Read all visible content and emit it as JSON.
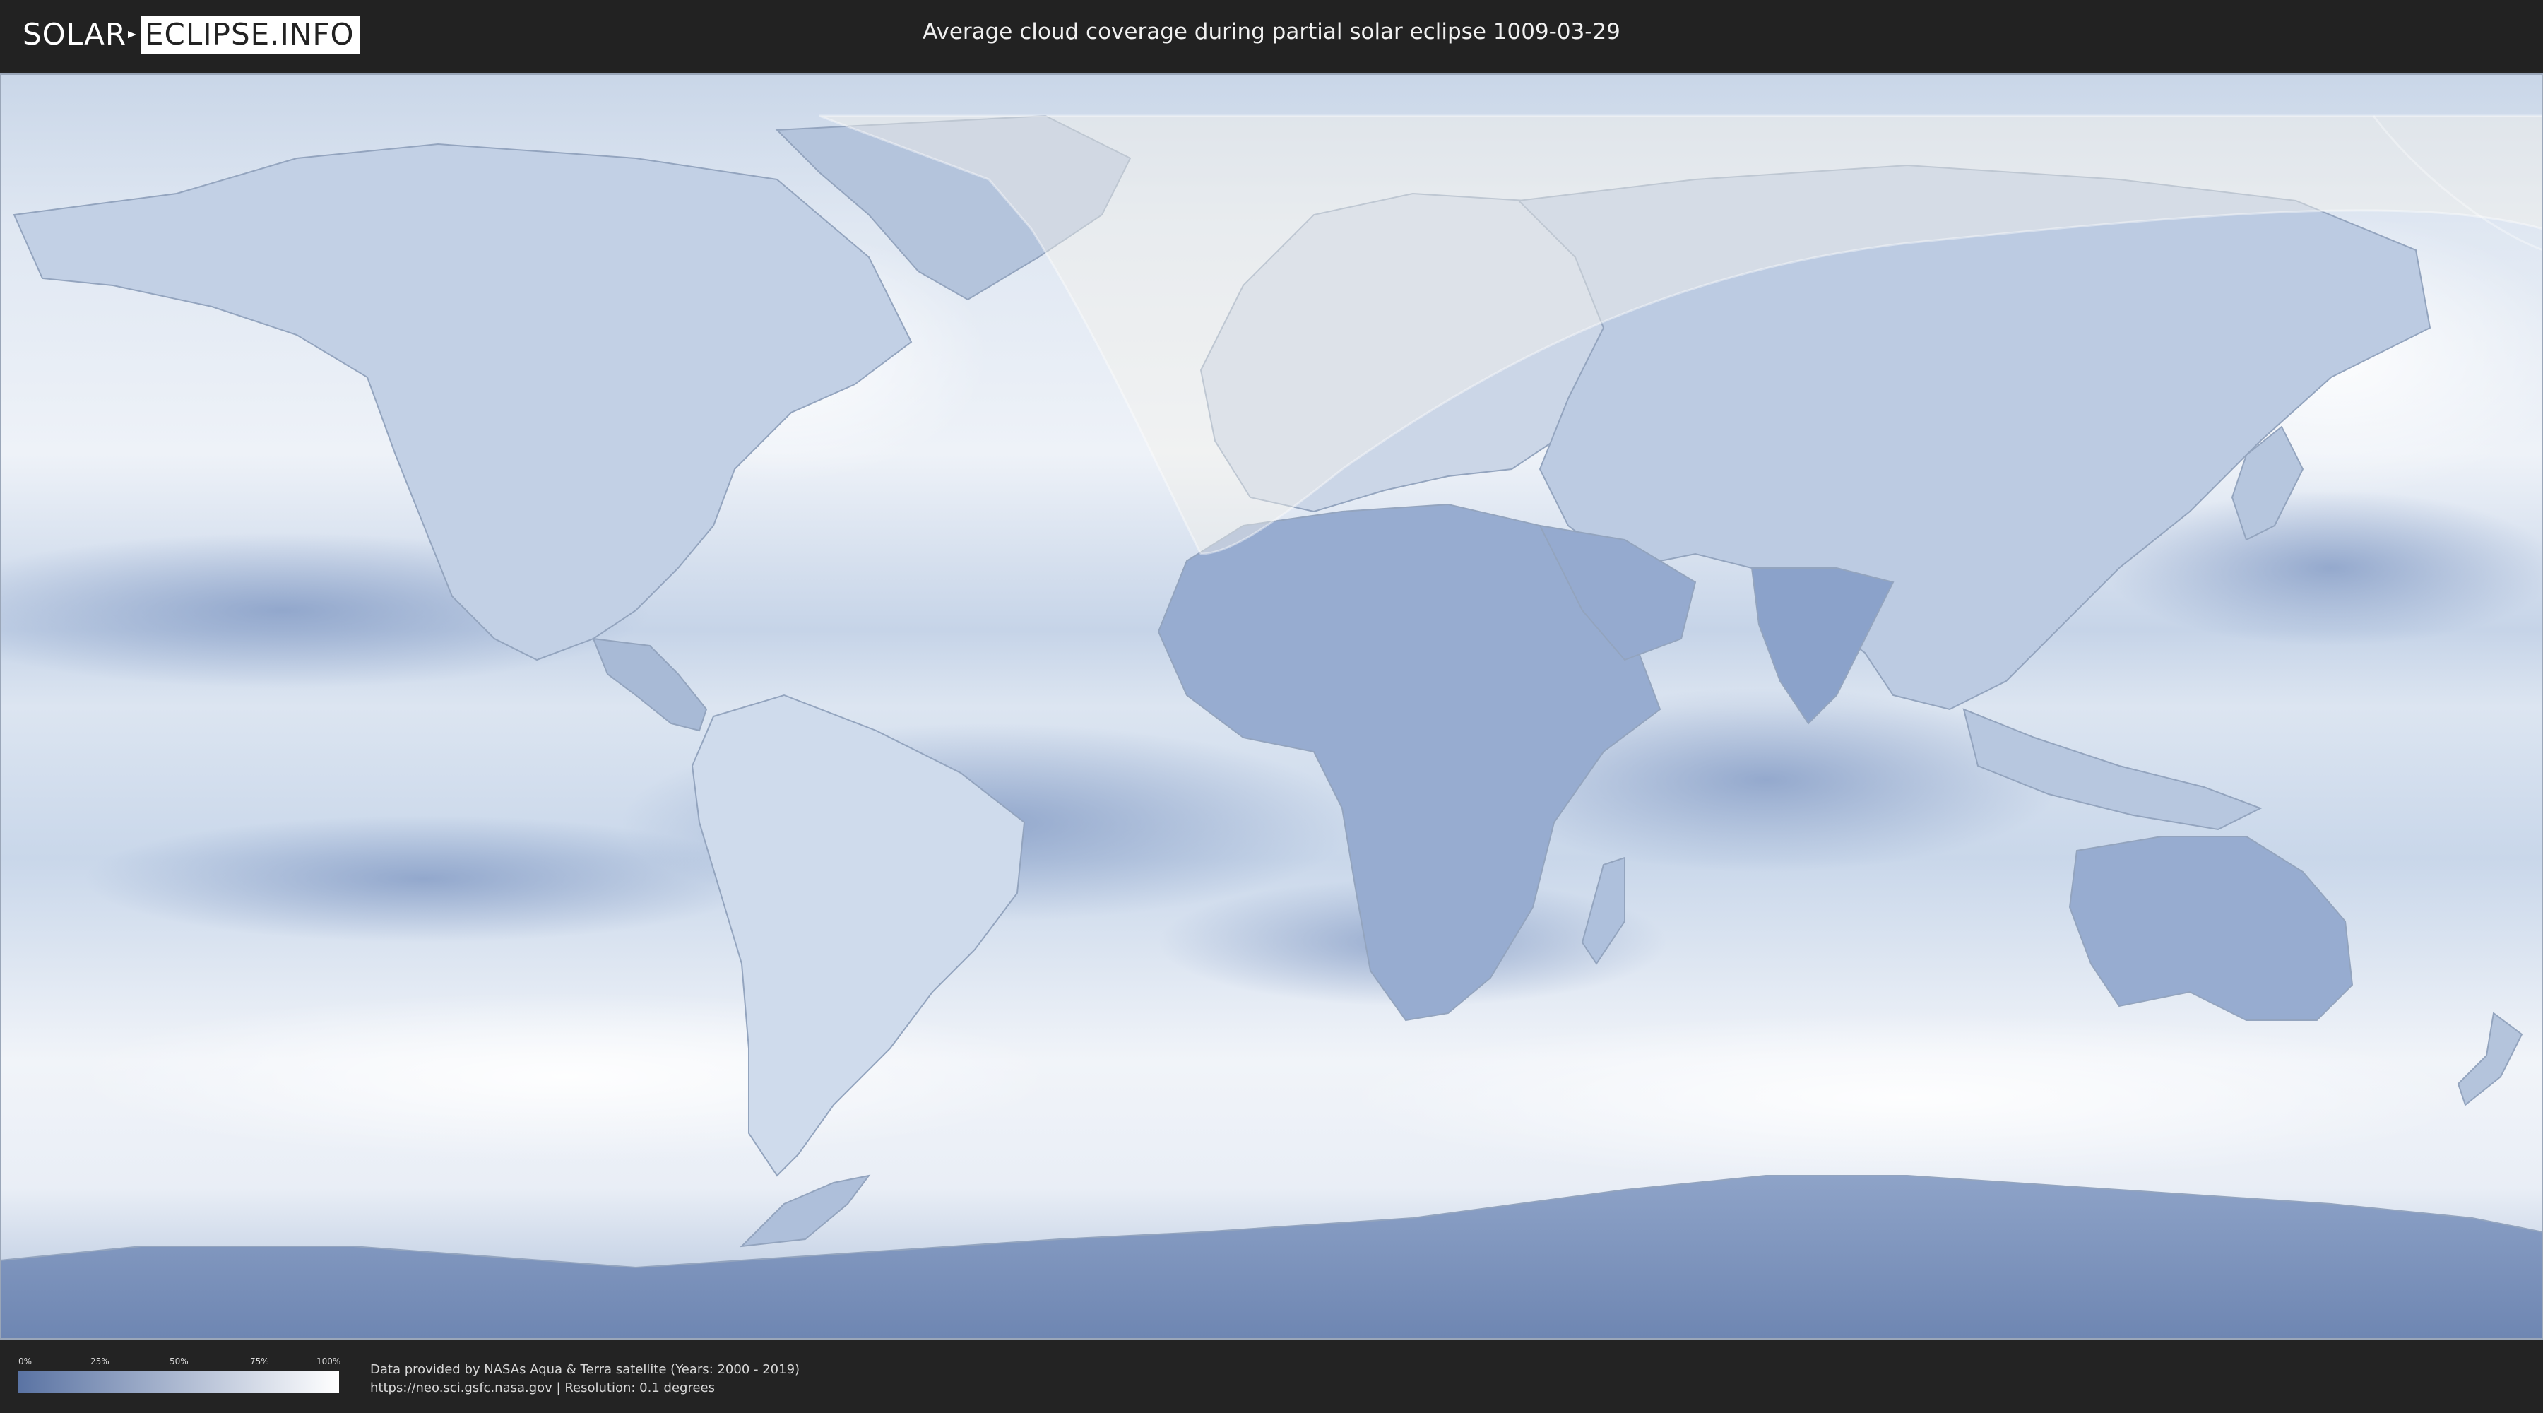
{
  "header": {
    "logo_left": "SOLAR",
    "logo_right": "ECLIPSE.INFO",
    "title": "Average cloud coverage during partial solar eclipse 1009-03-29"
  },
  "legend": {
    "ticks": [
      "0%",
      "25%",
      "50%",
      "75%",
      "100%"
    ],
    "colors": {
      "clear": "#5a73a3",
      "overcast": "#ffffff"
    }
  },
  "credits": {
    "line1": "Data provided by NASAs Aqua & Terra satellite (Years: 2000 - 2019)",
    "line2": "https://neo.sci.gsfc.nasa.gov | Resolution: 0.1 degrees"
  },
  "map": {
    "projection": "equirectangular",
    "colors": {
      "ocean_cloud": "#e8eef6",
      "low_cloud": "#6b84b3",
      "eclipse_overlay": "#f4f1ea",
      "borders": "#8fa0ba"
    }
  }
}
